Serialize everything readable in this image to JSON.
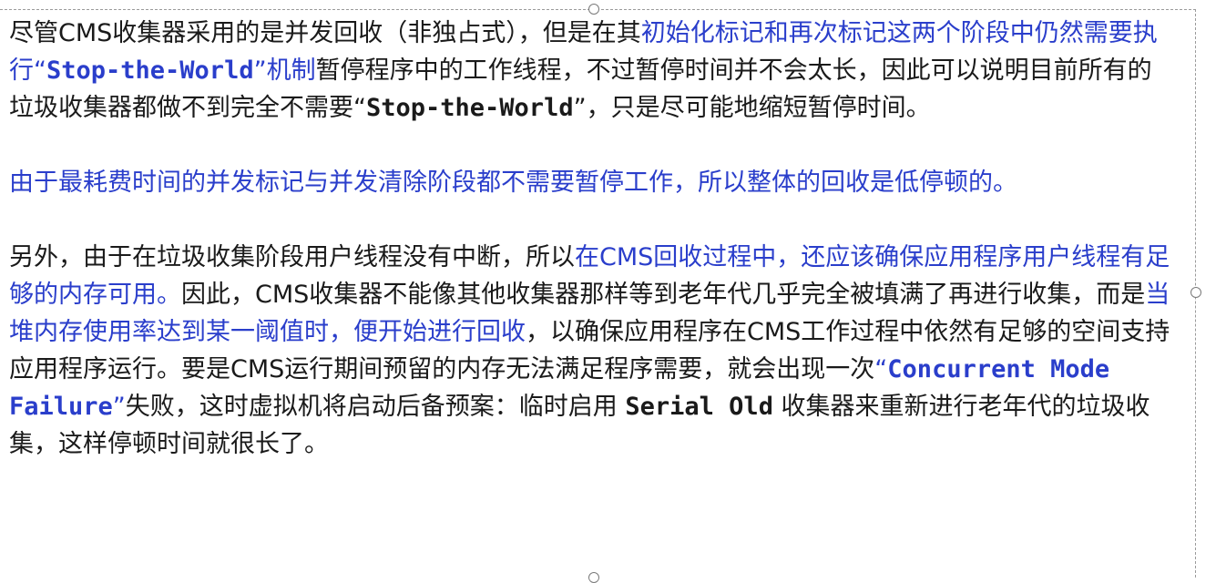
{
  "paragraphs": [
    {
      "runs": [
        {
          "text": "尽管",
          "style": ""
        },
        {
          "text": "CMS",
          "style": ""
        },
        {
          "text": "收集器采用的是并发回收（非独占式），但是在其",
          "style": ""
        },
        {
          "text": "初始化标记和再次标记这两个阶段中仍然需要执行",
          "style": "blue"
        },
        {
          "text": "“",
          "style": "blue"
        },
        {
          "text": "Stop-the-World",
          "style": "blue mono bold"
        },
        {
          "text": "”机制",
          "style": "blue"
        },
        {
          "text": "暂停程序中的工作线程，不过暂停时间并不会太长，因此可以说明目前所有的垃圾收集器都做不到完全不需要“",
          "style": ""
        },
        {
          "text": "Stop-the-World",
          "style": "mono bold"
        },
        {
          "text": "”，只是尽可能地缩短暂停时间。",
          "style": ""
        }
      ]
    },
    {
      "runs": [
        {
          "text": "由于最耗费时间的并发标记与并发清除阶段都不需要暂停工作，所以整体的回收是低停顿的。",
          "style": "blue"
        }
      ]
    },
    {
      "runs": [
        {
          "text": "另外，由于在垃圾收集阶段用户线程没有中断，所以",
          "style": ""
        },
        {
          "text": "在CMS回收过程中，还应该确保应用程序用户线程有足够的内存可用。",
          "style": "blue"
        },
        {
          "text": "因此，CMS收集器不能像其他收集器那样等到老年代几乎完全被填满了再进行收集，而是",
          "style": ""
        },
        {
          "text": "当堆内存使用率达到某一阈值时，便开始进行回收",
          "style": "blue"
        },
        {
          "text": "，以确保应用程序在CMS工作过程中依然有足够的空间支持应用程序运行。要是CMS运行期间预留的内存无法满足程序需要，就会出现一次",
          "style": ""
        },
        {
          "text": "“",
          "style": "blue"
        },
        {
          "text": "Concurrent Mode Failure",
          "style": "blue mono bold"
        },
        {
          "text": "”",
          "style": "blue"
        },
        {
          "text": "失败，这时虚拟机将启动后备预案：临时启用 ",
          "style": ""
        },
        {
          "text": "Serial Old",
          "style": "mono bold"
        },
        {
          "text": " 收集器来重新进行老年代的垃圾收集，这样停顿时间就很长了。",
          "style": ""
        }
      ]
    }
  ],
  "colors": {
    "text": "#1a1a1a",
    "highlight": "#2a3ecb",
    "border": "#9a9a9a"
  }
}
